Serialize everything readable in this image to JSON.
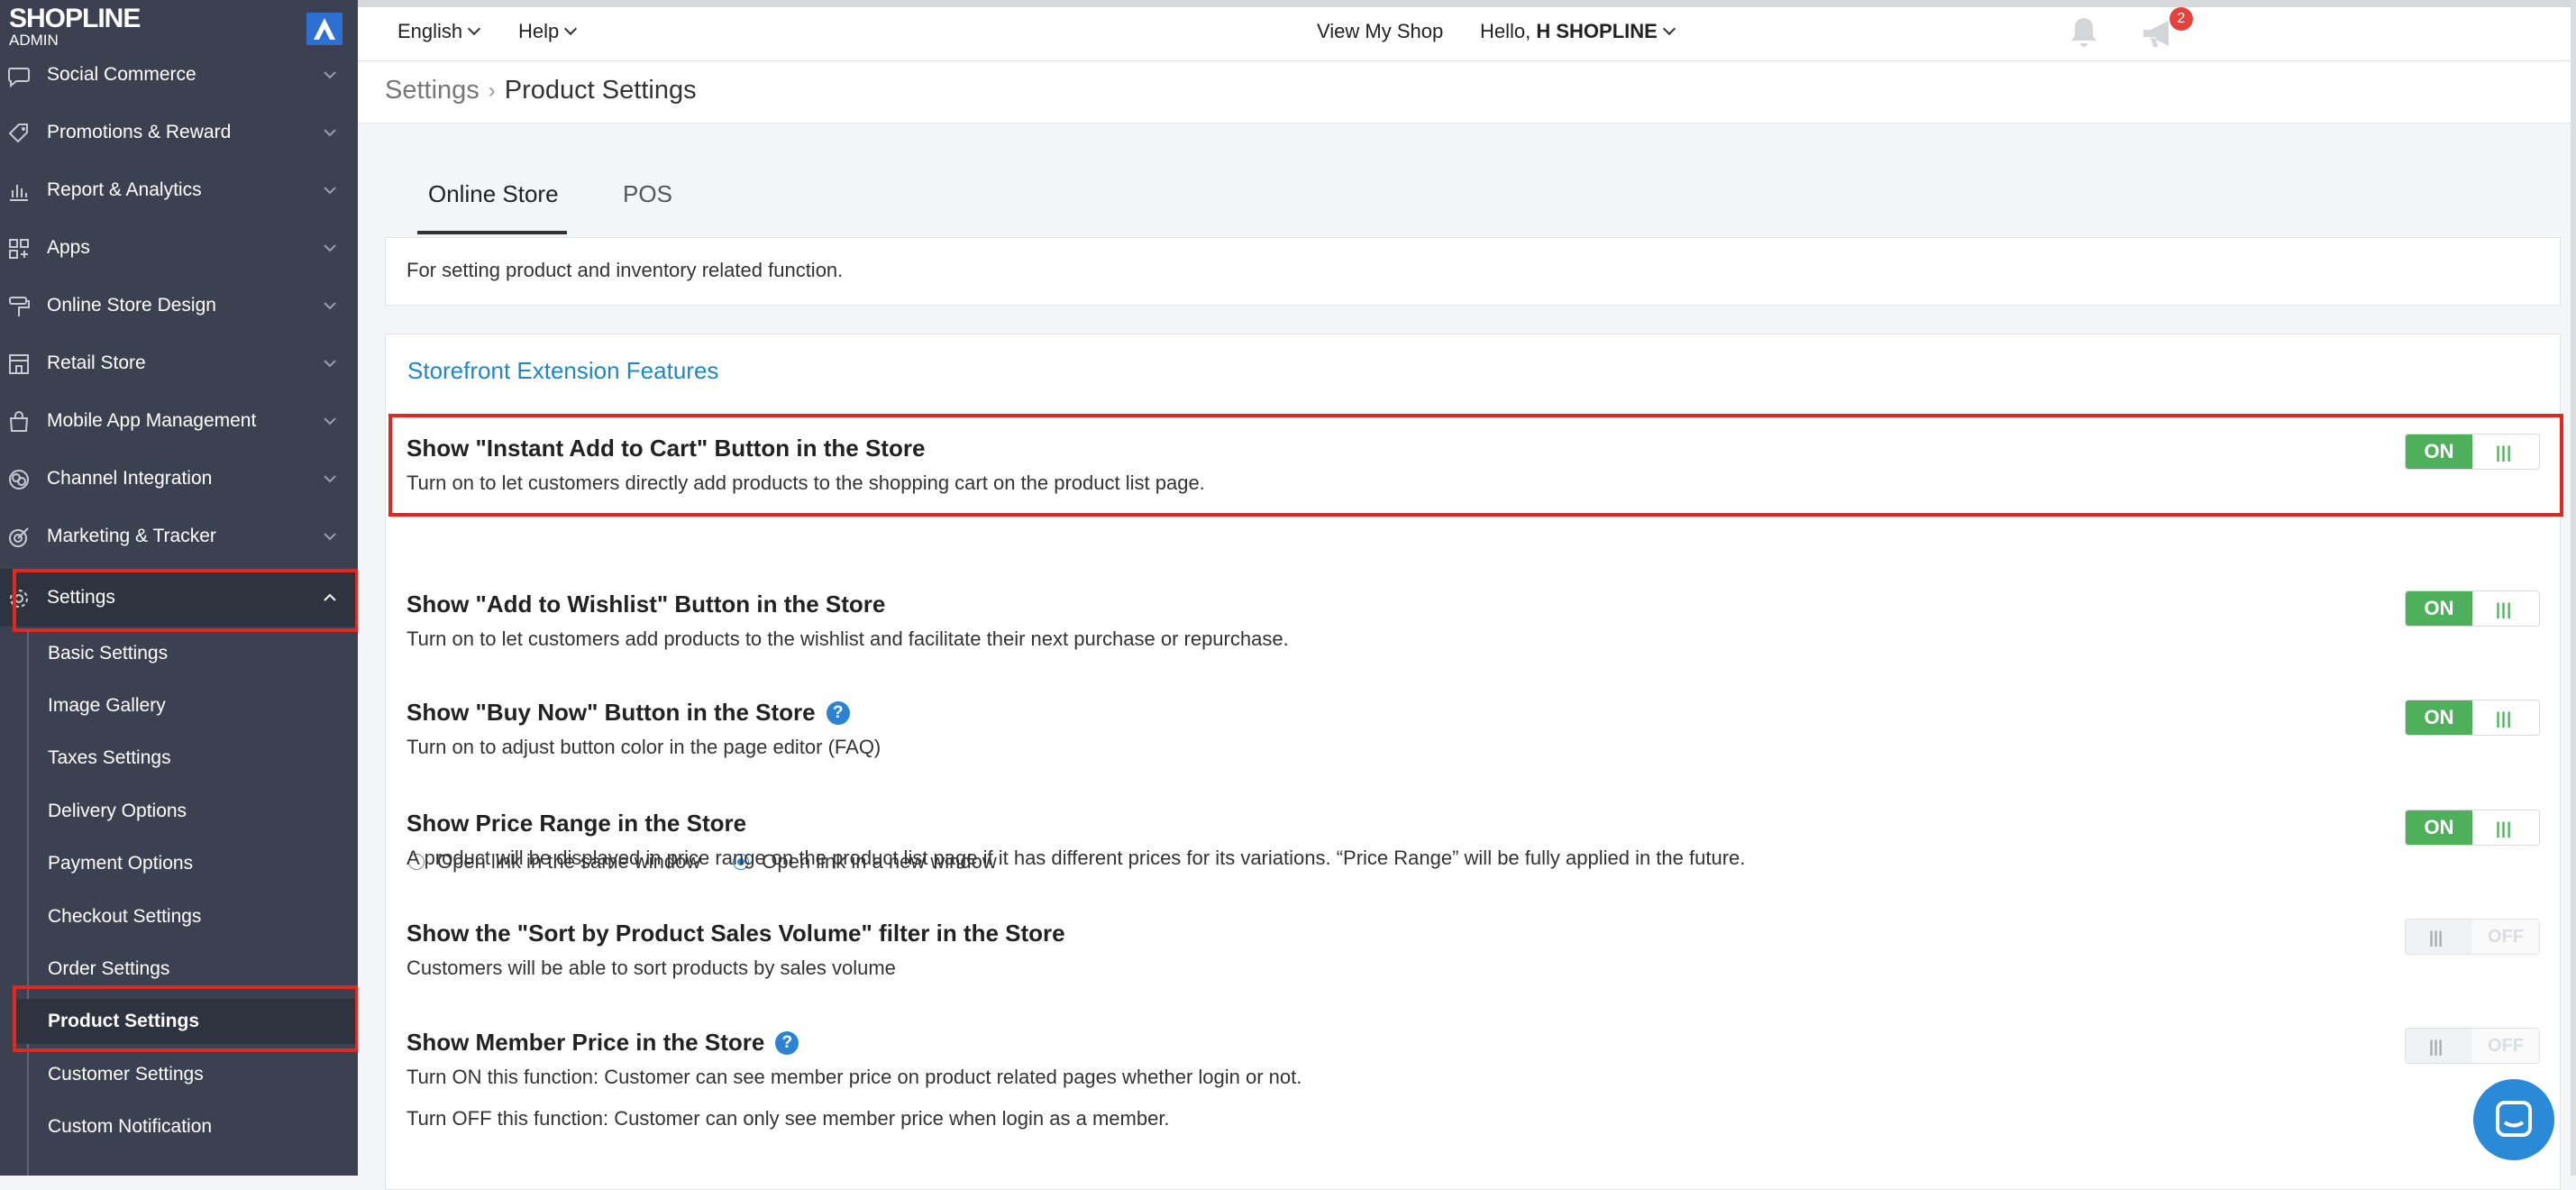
{
  "brand": {
    "name": "SHOPLINE",
    "sub": "ADMIN"
  },
  "sidebar": {
    "items": [
      {
        "label": "Social Commerce",
        "icon": "chat-bubble-icon"
      },
      {
        "label": "Promotions & Reward",
        "icon": "tag-icon"
      },
      {
        "label": "Report & Analytics",
        "icon": "bar-chart-icon"
      },
      {
        "label": "Apps",
        "icon": "apps-grid-icon"
      },
      {
        "label": "Online Store Design",
        "icon": "paint-roller-icon"
      },
      {
        "label": "Retail Store",
        "icon": "store-icon"
      },
      {
        "label": "Mobile App Management",
        "icon": "shopping-bag-icon"
      },
      {
        "label": "Channel Integration",
        "icon": "channel-icon"
      },
      {
        "label": "Marketing & Tracker",
        "icon": "target-icon"
      },
      {
        "label": "Settings",
        "icon": "gear-icon"
      }
    ],
    "sub_items": [
      "Basic Settings",
      "Image Gallery",
      "Taxes Settings",
      "Delivery Options",
      "Payment Options",
      "Checkout Settings",
      "Order Settings",
      "Product Settings",
      "Customer Settings",
      "Custom Notification"
    ]
  },
  "topbar": {
    "language": "English",
    "help": "Help",
    "notification_count": "2",
    "view_shop": "View My Shop",
    "greeting": "Hello,",
    "user": "H SHOPLINE"
  },
  "breadcrumb": {
    "parent": "Settings",
    "current": "Product Settings"
  },
  "tabs": [
    "Online Store",
    "POS"
  ],
  "description": "For setting product and inventory related function.",
  "section_title": "Storefront Extension Features",
  "settings": [
    {
      "title": "Show \"Instant Add to Cart\" Button in the Store",
      "desc": "Turn on to let customers directly add products to the shopping cart on the product list page.",
      "state": "ON"
    },
    {
      "title": "Show \"Add to Wishlist\" Button in the Store",
      "desc": "Turn on to let customers add products to the wishlist and facilitate their next purchase or repurchase.",
      "state": "ON"
    },
    {
      "title": "Show \"Buy Now\" Button in the Store",
      "desc": "Turn on to adjust button color in the page editor (FAQ)",
      "state": "ON"
    },
    {
      "title": "Show Price Range in the Store",
      "desc": "A product will be displayed in price range on the product list page if it has different prices for its variations. “Price Range” will be fully applied in the future.",
      "state": "ON"
    },
    {
      "title": "Show the \"Sort by Product Sales Volume\" filter in the Store",
      "desc": "Customers will be able to sort products by sales volume",
      "state": "OFF"
    },
    {
      "title": "Show Member Price in the Store",
      "desc": "Turn ON this function: Customer can see member price on product related pages whether login or not.",
      "desc2": "Turn OFF this function: Customer can only see member price when login as a member.",
      "state": "OFF"
    }
  ],
  "radios": {
    "same_window": "Open link in the same window",
    "new_window": "Open link in a new window",
    "selected": "new_window"
  },
  "help_glyph": "?",
  "toggle_grip": "|||",
  "colors": {
    "sidebar": "#3b4150",
    "accent": "#1c87c9",
    "on": "#4fb05b",
    "highlight": "#e0281e"
  }
}
